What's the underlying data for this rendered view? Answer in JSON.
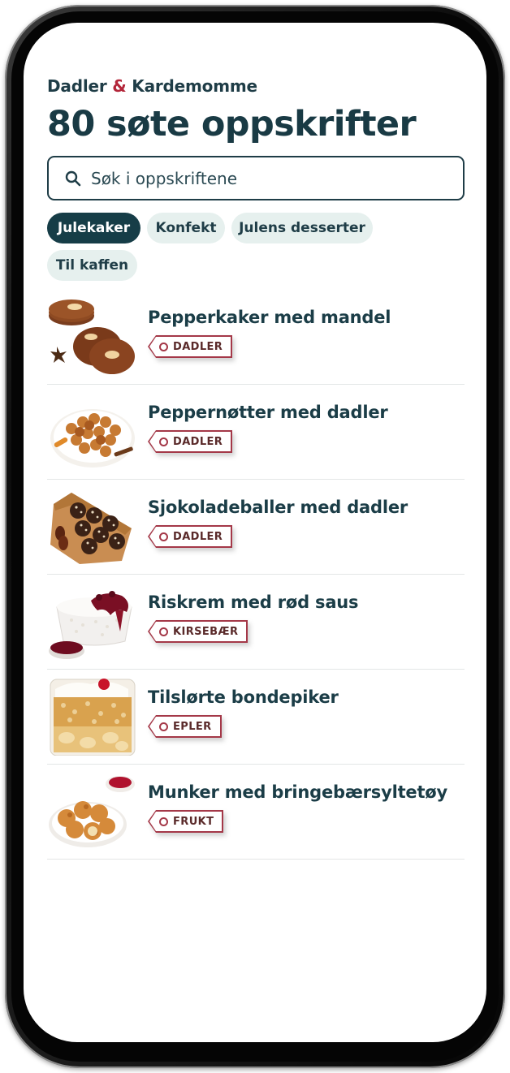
{
  "brand": {
    "part1": "Dadler",
    "amp": "&",
    "part2": "Kardemomme"
  },
  "page_title": "80 søte oppskrifter",
  "search": {
    "placeholder": "Søk i oppskriftene",
    "icon": "search-icon"
  },
  "filters": [
    {
      "label": "Julekaker",
      "active": true
    },
    {
      "label": "Konfekt",
      "active": false
    },
    {
      "label": "Julens desserter",
      "active": false
    },
    {
      "label": "Til kaffen",
      "active": false
    }
  ],
  "recipes": [
    {
      "title": "Pepperkaker med mandel",
      "tag": "DADLER",
      "image": "gingerbread-cookies-image"
    },
    {
      "title": "Peppernøtter med dadler",
      "tag": "DADLER",
      "image": "pepper-nuts-image"
    },
    {
      "title": "Sjokoladeballer med dadler",
      "tag": "DADLER",
      "image": "chocolate-balls-image"
    },
    {
      "title": "Riskrem med rød saus",
      "tag": "KIRSEBÆR",
      "image": "rice-cream-image"
    },
    {
      "title": "Tilslørte bondepiker",
      "tag": "EPLER",
      "image": "apple-trifle-image"
    },
    {
      "title": "Munker med bringebærsyltetøy",
      "tag": "FRUKT",
      "image": "munker-image"
    }
  ],
  "colors": {
    "primary": "#163d47",
    "accent": "#b3263a",
    "chip_bg": "#e6f0ee",
    "tag_border": "#a43848"
  }
}
